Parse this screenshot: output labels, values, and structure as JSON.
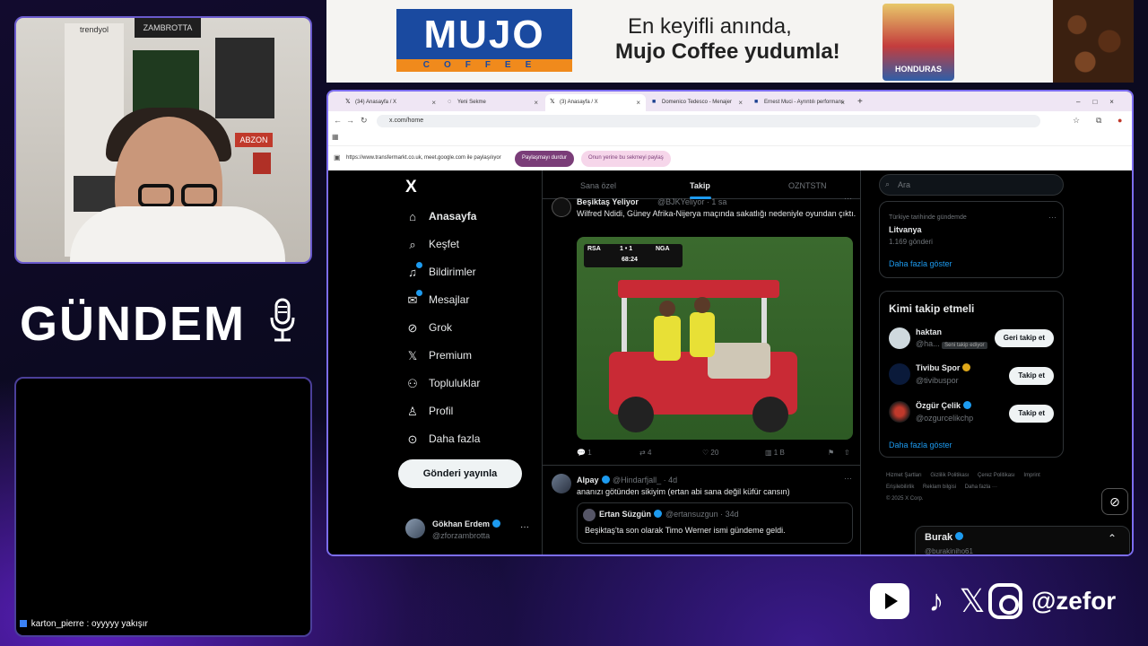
{
  "stream": {
    "webcam_labels": {
      "brand": "trendyol",
      "top_sign": "ZAMBROTTA",
      "jersey_name": "ABZON"
    },
    "overlay_title": "GÜNDEM",
    "chat": {
      "user": "karton_pierre",
      "message": "oyyyyy yakışır"
    },
    "social_handle": "@zefor",
    "social_icons": [
      "youtube-icon",
      "tiktok-icon",
      "x-icon",
      "instagram-icon"
    ]
  },
  "ad": {
    "logo": "MUJO",
    "logo_sub": "COFFEE",
    "line1": "En keyifli anında,",
    "line2": "Mujo Coffee yudumla!",
    "pack_label": "HONDURAS",
    "colors": {
      "logo_blue": "#1a4aa0",
      "logo_orange": "#f08a1c"
    }
  },
  "browser": {
    "tabs": [
      {
        "label": "(34) Anasayfa / X"
      },
      {
        "label": "Yeni Sekme"
      },
      {
        "label": "(3) Anasayfa / X"
      },
      {
        "label": "Domenico Tedesco - Menajer"
      },
      {
        "label": "Ernest Muci - Ayrıntılı performans"
      }
    ],
    "url": "x.com/home",
    "share_bar": {
      "text": "https://www.transfermarkt.co.uk, meet.google.com ile paylaşılıyor",
      "stop_label": "Paylaşmayı durdur",
      "hide_label": "Onun yerine bu sekmeyi paylaş"
    }
  },
  "x": {
    "logo": "X",
    "nav": [
      {
        "label": "Anasayfa",
        "icon": "home-icon"
      },
      {
        "label": "Keşfet",
        "icon": "search-icon"
      },
      {
        "label": "Bildirimler",
        "icon": "bell-icon"
      },
      {
        "label": "Mesajlar",
        "icon": "mail-icon"
      },
      {
        "label": "Grok",
        "icon": "grok-icon"
      },
      {
        "label": "Premium",
        "icon": "x-premium-icon"
      },
      {
        "label": "Topluluklar",
        "icon": "people-icon"
      },
      {
        "label": "Profil",
        "icon": "person-icon"
      },
      {
        "label": "Daha fazla",
        "icon": "more-circle-icon"
      }
    ],
    "post_button": "Gönderi yayınla",
    "account": {
      "name": "Gökhan Erdem",
      "handle": "@zforzambrotta"
    },
    "feed_tabs": [
      "Sana özel",
      "Takip",
      "OZNTSTN"
    ],
    "posts": [
      {
        "name": "Beşiktaş Yeliyor",
        "handle": "@BJKYeliyor · 1 sa",
        "text": "Wilfred Ndidi, Güney Afrika-Nijerya maçında sakatlığı nedeniyle oyundan çıktı.",
        "scorebug": {
          "home": "RSA",
          "score": "1 • 1",
          "away": "NGA",
          "clock": "68:24"
        },
        "stats": {
          "replies": "1",
          "reposts": "4",
          "likes": "20",
          "views": "1 B"
        }
      },
      {
        "name": "Alpay",
        "handle": "@Hindarfjall_ · 4d",
        "text": "ananızı götünden sikiyim (ertan abi sana değil küfür cansın)",
        "quote": {
          "name": "Ertan Süzgün",
          "handle": "@ertansuzgun · 34d",
          "text": "Beşiktaş'ta son olarak Timo Werner ismi gündeme geldi."
        }
      }
    ],
    "search_placeholder": "Ara",
    "trend": {
      "context": "Türkiye tarihinde gündemde",
      "title": "Litvanya",
      "count": "1.169 gönderi",
      "more": "Daha fazla göster"
    },
    "who_to_follow": {
      "title": "Kimi takip etmeli",
      "items": [
        {
          "name": "haktan",
          "handle": "@ha...",
          "badge": "Seni takip ediyor",
          "button": "Geri takip et"
        },
        {
          "name": "Tivibu Spor",
          "handle": "@tivibuspor",
          "button": "Takip et"
        },
        {
          "name": "Özgür Çelik",
          "handle": "@ozgurcelikchp",
          "button": "Takip et"
        }
      ],
      "more": "Daha fazla göster"
    },
    "footer": [
      "Hizmet Şartları",
      "Gizlilik Politikası",
      "Çerez Politikası",
      "Imprint",
      "Erişilebilirlik",
      "Reklam bilgisi",
      "Daha fazla ···",
      "© 2025 X Corp."
    ],
    "dm_drawer": {
      "name": "Burak",
      "handle": "@burakiniho61"
    }
  }
}
